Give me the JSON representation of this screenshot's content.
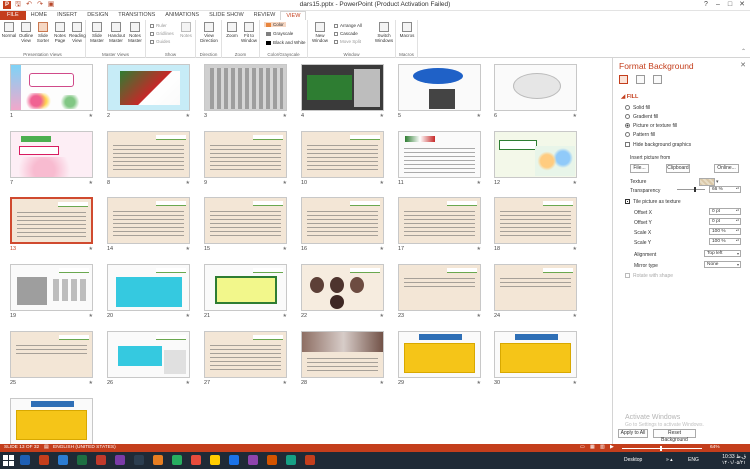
{
  "window": {
    "title": "dars15.pptx - PowerPoint (Product Activation Failed)",
    "controls": [
      "?",
      "–",
      "□",
      "✕"
    ]
  },
  "qat": [
    "save-icon",
    "undo-icon",
    "redo-icon",
    "present-icon"
  ],
  "tabs": [
    {
      "label": "FILE",
      "kind": "file"
    },
    {
      "label": "HOME"
    },
    {
      "label": "INSERT"
    },
    {
      "label": "DESIGN"
    },
    {
      "label": "TRANSITIONS"
    },
    {
      "label": "ANIMATIONS"
    },
    {
      "label": "SLIDE SHOW"
    },
    {
      "label": "REVIEW"
    },
    {
      "label": "VIEW",
      "active": true
    }
  ],
  "ribbon": {
    "presentation_views": {
      "label": "Presentation Views",
      "buttons": [
        "Normal",
        "Outline View",
        "Slide Sorter",
        "Notes Page",
        "Reading View"
      ]
    },
    "master_views": {
      "label": "Master Views",
      "buttons": [
        "Slide Master",
        "Handout Master",
        "Notes Master"
      ]
    },
    "show": {
      "label": "Show",
      "items": [
        "Ruler",
        "Gridlines",
        "Guides"
      ],
      "notes": "Notes"
    },
    "direction": {
      "label": "Direction",
      "button": "View Direction"
    },
    "zoom": {
      "label": "Zoom",
      "buttons": [
        "Zoom",
        "Fit to Window"
      ]
    },
    "color": {
      "label": "Color/Grayscale",
      "items": [
        {
          "label": "Color",
          "swatch": "#e8853d"
        },
        {
          "label": "Grayscale",
          "swatch": "#7f7f7f"
        },
        {
          "label": "Black and White",
          "swatch": "#000000"
        }
      ]
    },
    "window": {
      "label": "Window",
      "new_window": "New Window",
      "items": [
        "Arrange All",
        "Cascade",
        "Move Split"
      ],
      "switch": "Switch Windows"
    },
    "macros": {
      "label": "Macros",
      "button": "Macros"
    }
  },
  "slides": [
    {
      "n": "1",
      "kind": "title"
    },
    {
      "n": "2",
      "kind": "photo"
    },
    {
      "n": "3",
      "kind": "gray"
    },
    {
      "n": "4",
      "kind": "dark"
    },
    {
      "n": "5",
      "kind": "blue"
    },
    {
      "n": "6",
      "kind": "cloud"
    },
    {
      "n": "7",
      "kind": "title2"
    },
    {
      "n": "8",
      "kind": "text"
    },
    {
      "n": "9",
      "kind": "text"
    },
    {
      "n": "10",
      "kind": "text"
    },
    {
      "n": "11",
      "kind": "flags"
    },
    {
      "n": "12",
      "kind": "kids"
    },
    {
      "n": "13",
      "kind": "text",
      "selected": true
    },
    {
      "n": "14",
      "kind": "text"
    },
    {
      "n": "15",
      "kind": "text"
    },
    {
      "n": "16",
      "kind": "text"
    },
    {
      "n": "17",
      "kind": "text"
    },
    {
      "n": "18",
      "kind": "text"
    },
    {
      "n": "19",
      "kind": "arrows"
    },
    {
      "n": "20",
      "kind": "cyan"
    },
    {
      "n": "21",
      "kind": "green"
    },
    {
      "n": "22",
      "kind": "faces"
    },
    {
      "n": "23",
      "kind": "short"
    },
    {
      "n": "24",
      "kind": "short"
    },
    {
      "n": "25",
      "kind": "short"
    },
    {
      "n": "26",
      "kind": "cyan2"
    },
    {
      "n": "27",
      "kind": "text"
    },
    {
      "n": "28",
      "kind": "photo2"
    },
    {
      "n": "29",
      "kind": "yellow"
    },
    {
      "n": "30",
      "kind": "yellow"
    },
    {
      "n": "31",
      "kind": "yellow"
    }
  ],
  "pane": {
    "title": "Format Background",
    "close": "✕",
    "section": "FILL",
    "options": [
      {
        "label": "Solid fill",
        "on": false
      },
      {
        "label": "Gradient fill",
        "on": false
      },
      {
        "label": "Picture or texture fill",
        "on": true
      },
      {
        "label": "Pattern fill",
        "on": false
      }
    ],
    "hide_graphics": "Hide background graphics",
    "insert_from": "Insert picture from",
    "file_btn": "File...",
    "clipboard_btn": "Clipboard",
    "online_btn": "Online...",
    "texture": "Texture",
    "transparency": "Transparency",
    "transparency_value": "66 %",
    "transparency_level": 0.66,
    "tile": "Tile picture as texture",
    "offset_x_label": "Offset X",
    "offset_x": "0 pt",
    "offset_y_label": "Offset Y",
    "offset_y": "0 pt",
    "scale_x_label": "Scale X",
    "scale_x": "100 %",
    "scale_y_label": "Scale Y",
    "scale_y": "100 %",
    "alignment_label": "Alignment",
    "alignment": "Top left",
    "mirror_label": "Mirror type",
    "mirror": "None",
    "rotate": "Rotate with shape",
    "activate_title": "Activate Windows",
    "activate_sub": "Go to Settings to activate Windows.",
    "apply_all": "Apply to All",
    "reset": "Reset Background"
  },
  "status": {
    "slide": "SLIDE 13 OF 32",
    "language": "ENGLISH (UNITED STATES)",
    "zoom": "64%"
  },
  "taskbar": {
    "apps": [
      "#1e5fb5",
      "#c43e1c",
      "#2b7cd3",
      "#1d6f42",
      "#c0392b",
      "#7a3ba8",
      "#2c3e50",
      "#e67e22",
      "#27ae60",
      "#e74c3c",
      "#ffcc00",
      "#1a73e8",
      "#8e44ad",
      "#d35400",
      "#16a085",
      "#c43e1c"
    ],
    "desktop": "Desktop",
    "lang": "ENG",
    "time": "10:33 ق.ظ",
    "date": "۱۴۰۱/۰۵/۲۱"
  }
}
